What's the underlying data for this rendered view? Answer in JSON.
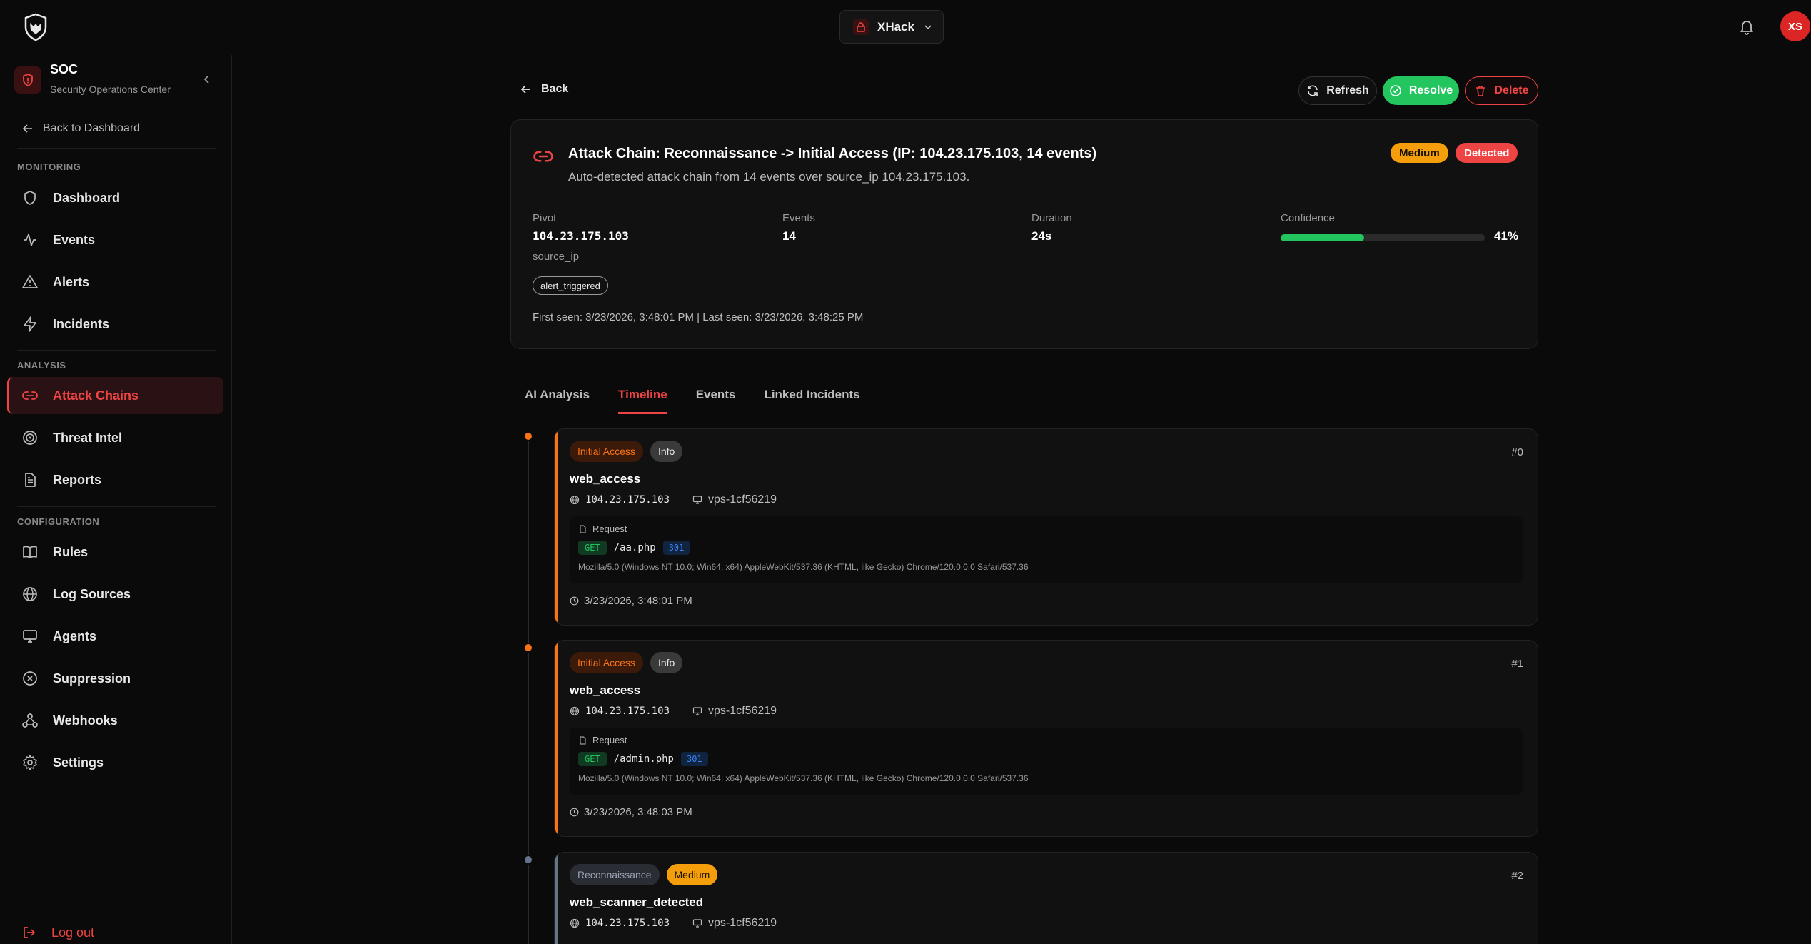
{
  "topbar": {
    "workspace": "XHack",
    "avatar_initials": "XS"
  },
  "sidebar": {
    "title": "SOC",
    "subtitle": "Security Operations Center",
    "back_to_dashboard": "Back to Dashboard",
    "sections": {
      "monitoring": "MONITORING",
      "analysis": "ANALYSIS",
      "configuration": "CONFIGURATION"
    },
    "items": {
      "dashboard": "Dashboard",
      "events": "Events",
      "alerts": "Alerts",
      "incidents": "Incidents",
      "attack_chains": "Attack Chains",
      "threat_intel": "Threat Intel",
      "reports": "Reports",
      "rules": "Rules",
      "log_sources": "Log Sources",
      "agents": "Agents",
      "suppression": "Suppression",
      "webhooks": "Webhooks",
      "settings": "Settings"
    },
    "active": "attack_chains",
    "logout": "Log out"
  },
  "toolbar": {
    "back": "Back",
    "refresh": "Refresh",
    "resolve": "Resolve",
    "delete": "Delete"
  },
  "chain": {
    "title": "Attack Chain: Reconnaissance -> Initial Access (IP: 104.23.175.103, 14 events)",
    "description": "Auto-detected attack chain from 14 events over source_ip 104.23.175.103.",
    "severity": "Medium",
    "status": "Detected",
    "pivot_label": "Pivot",
    "pivot_value": "104.23.175.103",
    "pivot_type": "source_ip",
    "events_label": "Events",
    "events_value": "14",
    "duration_label": "Duration",
    "duration_value": "24s",
    "confidence_label": "Confidence",
    "confidence_value": "41%",
    "confidence_fraction": 0.41,
    "tag": "alert_triggered",
    "seen": "First seen: 3/23/2026, 3:48:01 PM | Last seen: 3/23/2026, 3:48:25 PM"
  },
  "tabs": [
    "AI Analysis",
    "Timeline",
    "Events",
    "Linked Incidents"
  ],
  "active_tab": "Timeline",
  "timeline": [
    {
      "tactic": "Initial Access",
      "severity": "Info",
      "index": "#0",
      "name": "web_access",
      "ip": "104.23.175.103",
      "host": "vps-1cf56219",
      "request_label": "Request",
      "method": "GET",
      "path": "/aa.php",
      "status": "301",
      "user_agent": "Mozilla/5.0 (Windows NT 10.0; Win64; x64) AppleWebKit/537.36 (KHTML, like Gecko) Chrome/120.0.0.0 Safari/537.36",
      "time": "3/23/2026, 3:48:01 PM"
    },
    {
      "tactic": "Initial Access",
      "severity": "Info",
      "index": "#1",
      "name": "web_access",
      "ip": "104.23.175.103",
      "host": "vps-1cf56219",
      "request_label": "Request",
      "method": "GET",
      "path": "/admin.php",
      "status": "301",
      "user_agent": "Mozilla/5.0 (Windows NT 10.0; Win64; x64) AppleWebKit/537.36 (KHTML, like Gecko) Chrome/120.0.0.0 Safari/537.36",
      "time": "3/23/2026, 3:48:03 PM"
    },
    {
      "tactic": "Reconnaissance",
      "severity": "Medium",
      "index": "#2",
      "name": "web_scanner_detected",
      "ip": "104.23.175.103",
      "host": "vps-1cf56219"
    }
  ],
  "colors": {
    "accent": "#ef4444",
    "success": "#22c55e",
    "warning": "#f59e0b",
    "initial_access": "#f97316",
    "recon": "#64748b"
  }
}
